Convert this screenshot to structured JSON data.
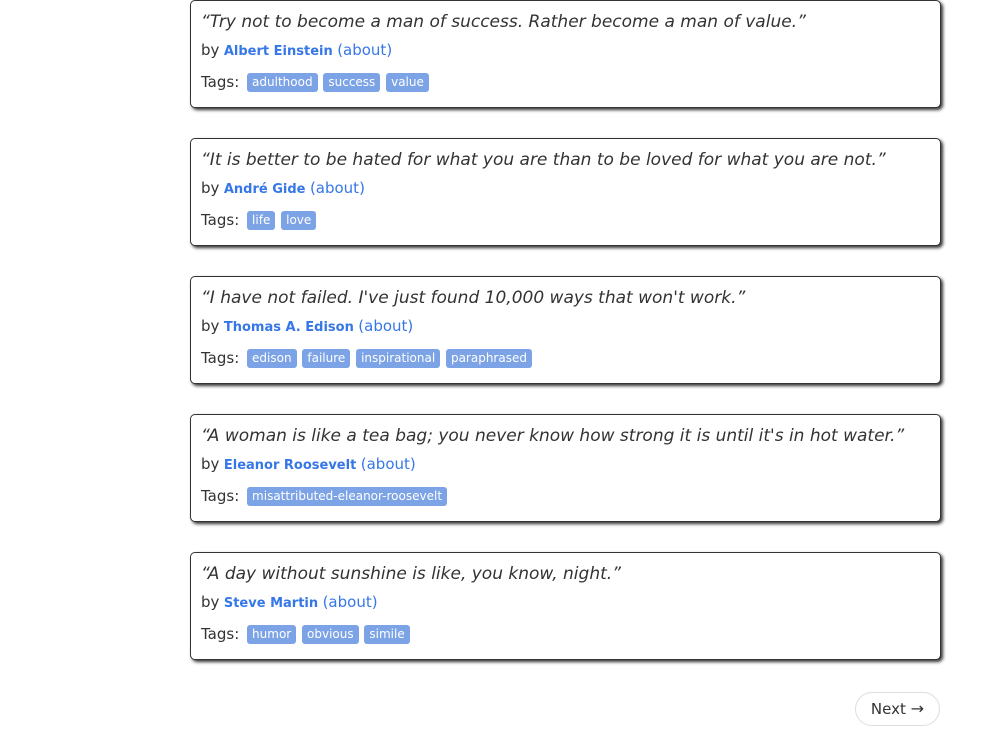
{
  "quotes": [
    {
      "text": "“Try not to become a man of success. Rather become a man of value.”",
      "by": "by",
      "author": "Albert Einstein",
      "about": "(about)",
      "tags_label": "Tags:",
      "tags": [
        "adulthood",
        "success",
        "value"
      ]
    },
    {
      "text": "“It is better to be hated for what you are than to be loved for what you are not.”",
      "by": "by",
      "author": "André Gide",
      "about": "(about)",
      "tags_label": "Tags:",
      "tags": [
        "life",
        "love"
      ]
    },
    {
      "text": "“I have not failed. I've just found 10,000 ways that won't work.”",
      "by": "by",
      "author": "Thomas A. Edison",
      "about": "(about)",
      "tags_label": "Tags:",
      "tags": [
        "edison",
        "failure",
        "inspirational",
        "paraphrased"
      ]
    },
    {
      "text": "“A woman is like a tea bag; you never know how strong it is until it's in hot water.”",
      "by": "by",
      "author": "Eleanor Roosevelt",
      "about": "(about)",
      "tags_label": "Tags:",
      "tags": [
        "misattributed-eleanor-roosevelt"
      ]
    },
    {
      "text": "“A day without sunshine is like, you know, night.”",
      "by": "by",
      "author": "Steve Martin",
      "about": "(about)",
      "tags_label": "Tags:",
      "tags": [
        "humor",
        "obvious",
        "simile"
      ]
    }
  ],
  "pager": {
    "next_label": "Next",
    "next_arrow": "→"
  },
  "colors": {
    "link": "#3677e8",
    "tag_bg": "#7ca3e5",
    "text": "#333333"
  }
}
